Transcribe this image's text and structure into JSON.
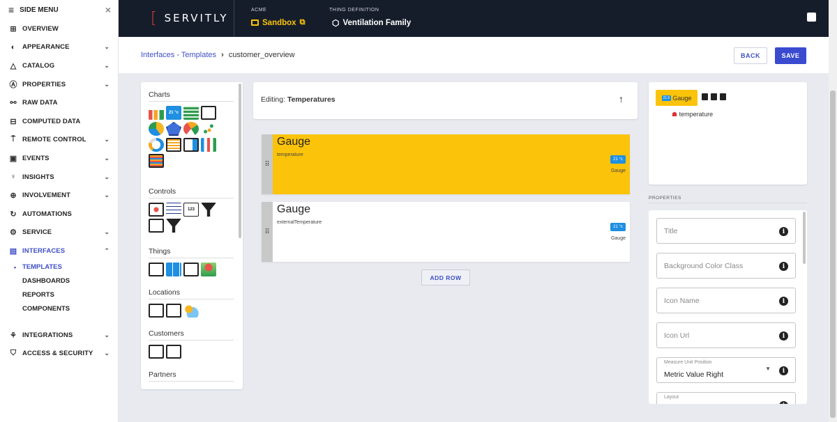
{
  "sidebar": {
    "title": "SIDE MENU",
    "items": [
      {
        "label": "OVERVIEW",
        "icon": "grid-icon",
        "chevron": false
      },
      {
        "label": "APPEARANCE",
        "icon": "palette-icon",
        "chevron": true
      },
      {
        "label": "CATALOG",
        "icon": "shapes-icon",
        "chevron": true
      },
      {
        "label": "PROPERTIES",
        "icon": "letter-a-box-icon",
        "chevron": true
      },
      {
        "label": "RAW DATA",
        "icon": "graph-nodes-icon",
        "chevron": false
      },
      {
        "label": "COMPUTED DATA",
        "icon": "calculator-icon",
        "chevron": false
      },
      {
        "label": "REMOTE CONTROL",
        "icon": "remote-icon",
        "chevron": true
      },
      {
        "label": "EVENTS",
        "icon": "calendar-icon",
        "chevron": true
      },
      {
        "label": "INSIGHTS",
        "icon": "lightbulb-icon",
        "chevron": true
      },
      {
        "label": "INVOLVEMENT",
        "icon": "plus-circle-icon",
        "chevron": true
      },
      {
        "label": "AUTOMATIONS",
        "icon": "cycle-icon",
        "chevron": false
      },
      {
        "label": "SERVICE",
        "icon": "service-icon",
        "chevron": true
      },
      {
        "label": "INTERFACES",
        "icon": "interfaces-icon",
        "chevron": true
      }
    ],
    "subitems": [
      {
        "label": "TEMPLATES"
      },
      {
        "label": "DASHBOARDS"
      },
      {
        "label": "REPORTS"
      },
      {
        "label": "COMPONENTS"
      }
    ],
    "bottom_items": [
      {
        "label": "INTEGRATIONS",
        "icon": "integrations-icon"
      },
      {
        "label": "ACCESS & SECURITY",
        "icon": "security-icon"
      }
    ]
  },
  "topbar": {
    "logo": "SERVITLY",
    "tenant_label": "ACME",
    "tenant_value": "Sandbox",
    "thing_label": "THING DEFINITION",
    "thing_value": "Ventilation Family"
  },
  "header": {
    "breadcrumb_link": "Interfaces - Templates",
    "breadcrumb_current": "customer_overview",
    "back_label": "BACK",
    "save_label": "SAVE"
  },
  "palette": {
    "sections": [
      "Charts",
      "Controls",
      "Things",
      "Locations",
      "Customers",
      "Partners"
    ],
    "badge_text": "21 °c"
  },
  "editor": {
    "prefix": "Editing:",
    "name": "Temperatures",
    "rows": [
      {
        "title": "Gauge",
        "metric": "temperature",
        "widget_label": "Gauge",
        "badge": "21 °c"
      },
      {
        "title": "Gauge",
        "metric": "externalTemperature",
        "widget_label": "Gauge",
        "badge": "21 °c"
      }
    ],
    "add_row_label": "ADD ROW"
  },
  "tree": {
    "root_label": "Gauge",
    "root_badge": "21.5",
    "leaf_label": "temperature"
  },
  "properties": {
    "section_label": "PROPERTIES",
    "fields": [
      {
        "label": "Title"
      },
      {
        "label": "Background Color Class"
      },
      {
        "label": "Icon Name"
      },
      {
        "label": "Icon Url"
      }
    ],
    "measure_label": "Measure Unit Position",
    "measure_value": "Metric Value Right",
    "layout_label": "Layout"
  },
  "colors": {
    "accent": "#3f4fc4",
    "topbar": "#161d2a",
    "selected_row": "#fbc30a",
    "badge": "#1e8fe1"
  }
}
